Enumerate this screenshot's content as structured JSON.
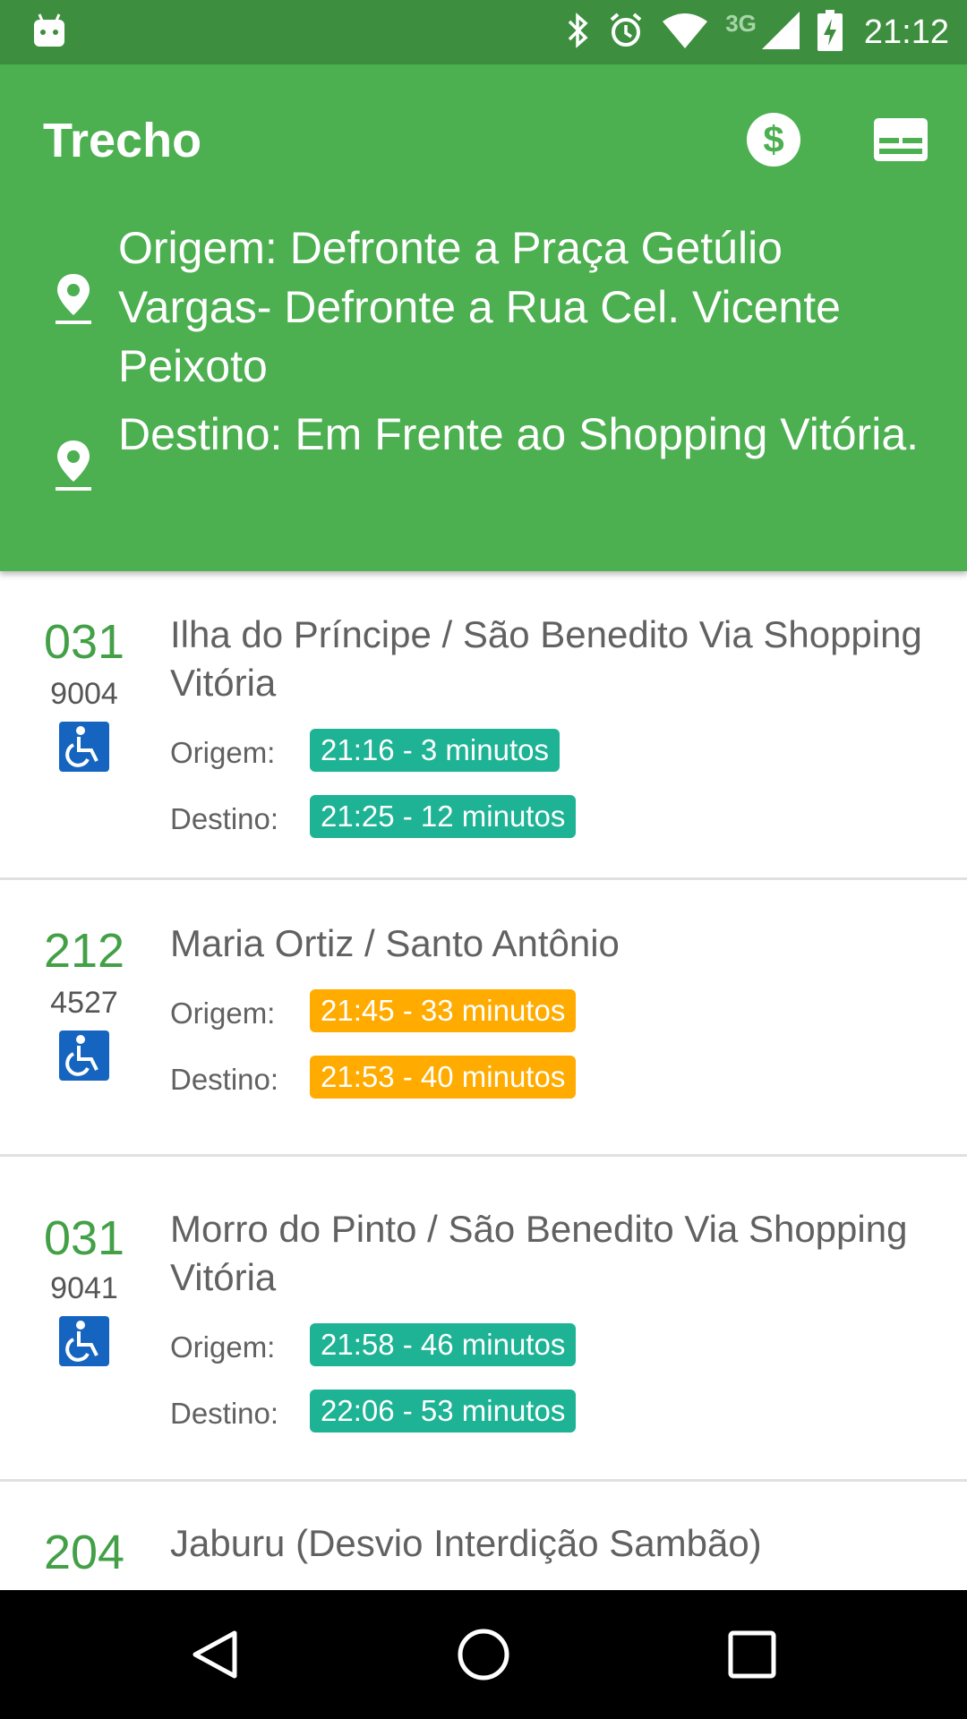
{
  "status_bar": {
    "network": "3G",
    "time": "21:12",
    "icons": [
      "android-icon",
      "bluetooth-icon",
      "alarm-icon",
      "wifi-icon",
      "signal-icon",
      "battery-charging-icon"
    ]
  },
  "header": {
    "title": "Trecho",
    "fare_icon": "dollar-circle-icon",
    "card_icon": "card-icon",
    "origin": "Origem: Defronte a Praça Getúlio Vargas- Defronte a Rua Cel. Vicente Peixoto",
    "destination": "Destino: Em Frente ao Shopping Vitória."
  },
  "colors": {
    "status_bar": "#3d8f3f",
    "header": "#4caf50",
    "route_number": "#43a047",
    "on_time": "#1db394",
    "late": "#ffab00",
    "wheelchair": "#1565c0"
  },
  "labels": {
    "origin": "Origem:",
    "destination": "Destino:"
  },
  "trips": [
    {
      "route": "031",
      "code": "9004",
      "accessible": true,
      "name": "Ilha do Príncipe / São Benedito Via Shopping Vitória",
      "origin_time": "21:16 - 3 minutos",
      "destination_time": "21:25 - 12 minutos",
      "status_color": "#1db394"
    },
    {
      "route": "212",
      "code": "4527",
      "accessible": true,
      "name": "Maria Ortiz / Santo Antônio",
      "origin_time": "21:45 - 33 minutos",
      "destination_time": "21:53 - 40 minutos",
      "status_color": "#ffab00"
    },
    {
      "route": "031",
      "code": "9041",
      "accessible": true,
      "name": "Morro do Pinto / São Benedito Via Shopping Vitória",
      "origin_time": "21:58 - 46 minutos",
      "destination_time": "22:06 - 53 minutos",
      "status_color": "#1db394"
    },
    {
      "route": "204",
      "name": "Jaburu (Desvio Interdição Sambão)"
    }
  ],
  "nav_bar": {
    "back": "back-icon",
    "home": "home-icon",
    "recents": "recents-icon"
  }
}
